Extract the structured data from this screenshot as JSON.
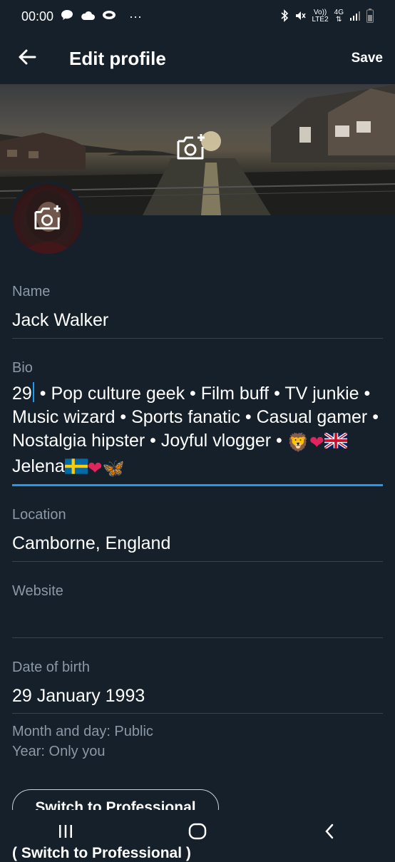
{
  "status_bar": {
    "time": "00:00",
    "overflow": "···",
    "network_top": "Vo))",
    "network_bottom": "LTE2",
    "gen": "4G",
    "icons": [
      "chat-bubble-icon",
      "cloud-icon",
      "notification-icon",
      "bluetooth-icon",
      "mute-icon",
      "signal-icon",
      "battery-icon"
    ]
  },
  "app_bar": {
    "title": "Edit profile",
    "save_label": "Save",
    "back_icon": "back-arrow-icon"
  },
  "banner": {
    "camera_icon": "add-photo-icon"
  },
  "avatar": {
    "camera_icon": "add-photo-icon"
  },
  "fields": {
    "name": {
      "label": "Name",
      "value": "Jack Walker"
    },
    "bio": {
      "label": "Bio",
      "before_caret": "29",
      "after_caret": " • Pop culture geek • Film buff • TV junkie • Music wizard • Sports fanatic • Casual gamer • Nostalgia hipster • Joyful vlogger • ",
      "emoji_lion": "🦁",
      "emoji_heart": "❤",
      "name_in_bio": "Jelena",
      "emoji_butterfly": "🦋"
    },
    "location": {
      "label": "Location",
      "value": "Camborne, England"
    },
    "website": {
      "label": "Website",
      "value": ""
    },
    "dob": {
      "label": "Date of birth",
      "value": "29 January 1993"
    }
  },
  "visibility": {
    "month_day": "Month and day: Public",
    "year": "Year: Only you"
  },
  "buttons": {
    "switch_professional": "Switch to Professional",
    "behind_nav": "( Switch to Professional )"
  },
  "colors": {
    "background": "#15202b",
    "accent": "#1d9bf0",
    "label": "#8b98a5",
    "divider": "#38444d"
  }
}
